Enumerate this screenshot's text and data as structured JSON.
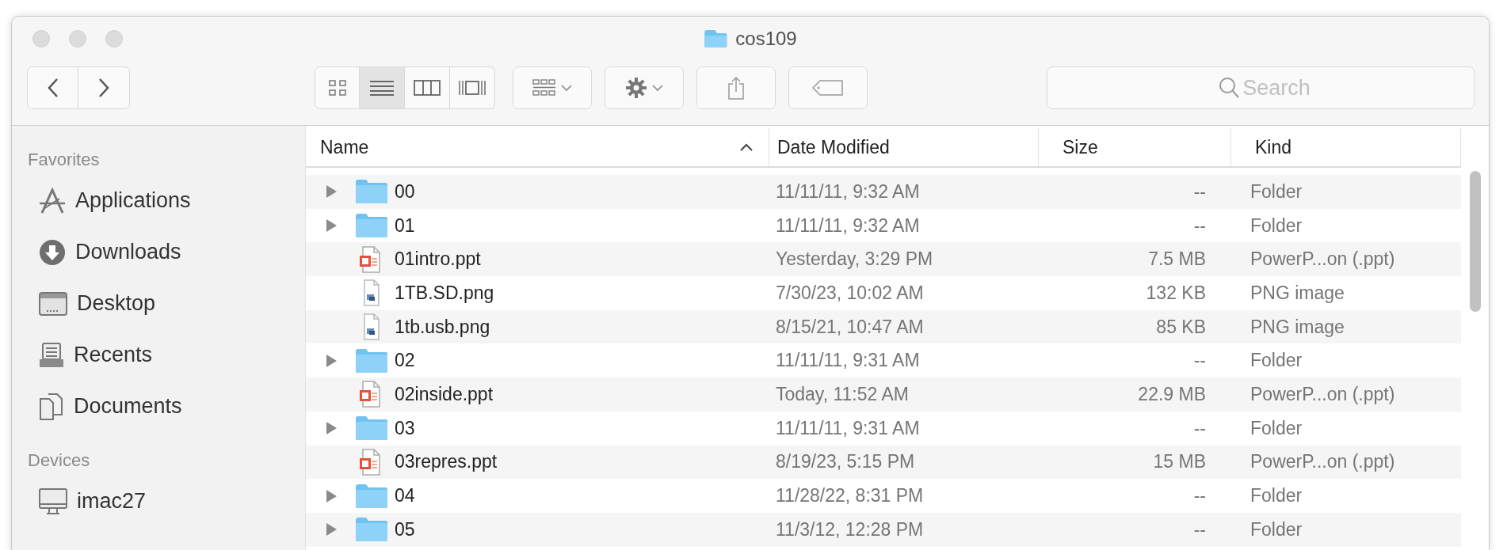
{
  "window": {
    "title": "cos109"
  },
  "toolbar": {
    "view_modes": [
      {
        "kind": "icons",
        "selected": false
      },
      {
        "kind": "list",
        "selected": true
      },
      {
        "kind": "columns",
        "selected": false
      },
      {
        "kind": "gallery",
        "selected": false
      }
    ],
    "search": {
      "placeholder": "Search"
    }
  },
  "sidebar": {
    "sections": [
      {
        "title": "Favorites",
        "items": [
          {
            "label": "Applications",
            "kind": "applications",
            "selected": false
          },
          {
            "label": "Downloads",
            "kind": "downloads",
            "selected": false
          },
          {
            "label": "Desktop",
            "kind": "desktop",
            "selected": false
          },
          {
            "label": "Recents",
            "kind": "recents",
            "selected": false
          },
          {
            "label": "Documents",
            "kind": "documents",
            "selected": false
          }
        ]
      },
      {
        "title": "Devices",
        "items": [
          {
            "label": "imac27",
            "kind": "computer",
            "selected": false
          }
        ]
      }
    ]
  },
  "table": {
    "columns": [
      {
        "label": "Name",
        "sorted": true,
        "ascending": true
      },
      {
        "label": "Date Modified",
        "sorted": false
      },
      {
        "label": "Size",
        "sorted": false
      },
      {
        "label": "Kind",
        "sorted": false
      }
    ],
    "rows": [
      {
        "kind": "folder",
        "expanded": false,
        "selected": false,
        "name": "00",
        "date_modified": "11/11/11, 9:32 AM",
        "size": "--",
        "file_kind": "Folder"
      },
      {
        "kind": "folder",
        "expanded": false,
        "selected": false,
        "name": "01",
        "date_modified": "11/11/11, 9:32 AM",
        "size": "--",
        "file_kind": "Folder"
      },
      {
        "kind": "presentation",
        "selected": false,
        "name": "01intro.ppt",
        "date_modified": "Yesterday, 3:29 PM",
        "size": "7.5 MB",
        "file_kind": "PowerP...on (.ppt)"
      },
      {
        "kind": "image",
        "selected": false,
        "name": "1TB.SD.png",
        "date_modified": "7/30/23, 10:02 AM",
        "size": "132 KB",
        "file_kind": "PNG image"
      },
      {
        "kind": "image",
        "selected": false,
        "name": "1tb.usb.png",
        "date_modified": "8/15/21, 10:47 AM",
        "size": "85 KB",
        "file_kind": "PNG image"
      },
      {
        "kind": "folder",
        "expanded": false,
        "selected": false,
        "name": "02",
        "date_modified": "11/11/11, 9:31 AM",
        "size": "--",
        "file_kind": "Folder"
      },
      {
        "kind": "presentation",
        "selected": false,
        "name": "02inside.ppt",
        "date_modified": "Today, 11:52 AM",
        "size": "22.9 MB",
        "file_kind": "PowerP...on (.ppt)"
      },
      {
        "kind": "folder",
        "expanded": false,
        "selected": false,
        "name": "03",
        "date_modified": "11/11/11, 9:31 AM",
        "size": "--",
        "file_kind": "Folder"
      },
      {
        "kind": "presentation",
        "selected": false,
        "name": "03repres.ppt",
        "date_modified": "8/19/23, 5:15 PM",
        "size": "15 MB",
        "file_kind": "PowerP...on (.ppt)"
      },
      {
        "kind": "folder",
        "expanded": false,
        "selected": false,
        "name": "04",
        "date_modified": "11/28/22, 8:31 PM",
        "size": "--",
        "file_kind": "Folder"
      },
      {
        "kind": "folder",
        "expanded": false,
        "selected": false,
        "name": "05",
        "date_modified": "11/3/12, 12:28 PM",
        "size": "--",
        "file_kind": "Folder"
      }
    ]
  }
}
